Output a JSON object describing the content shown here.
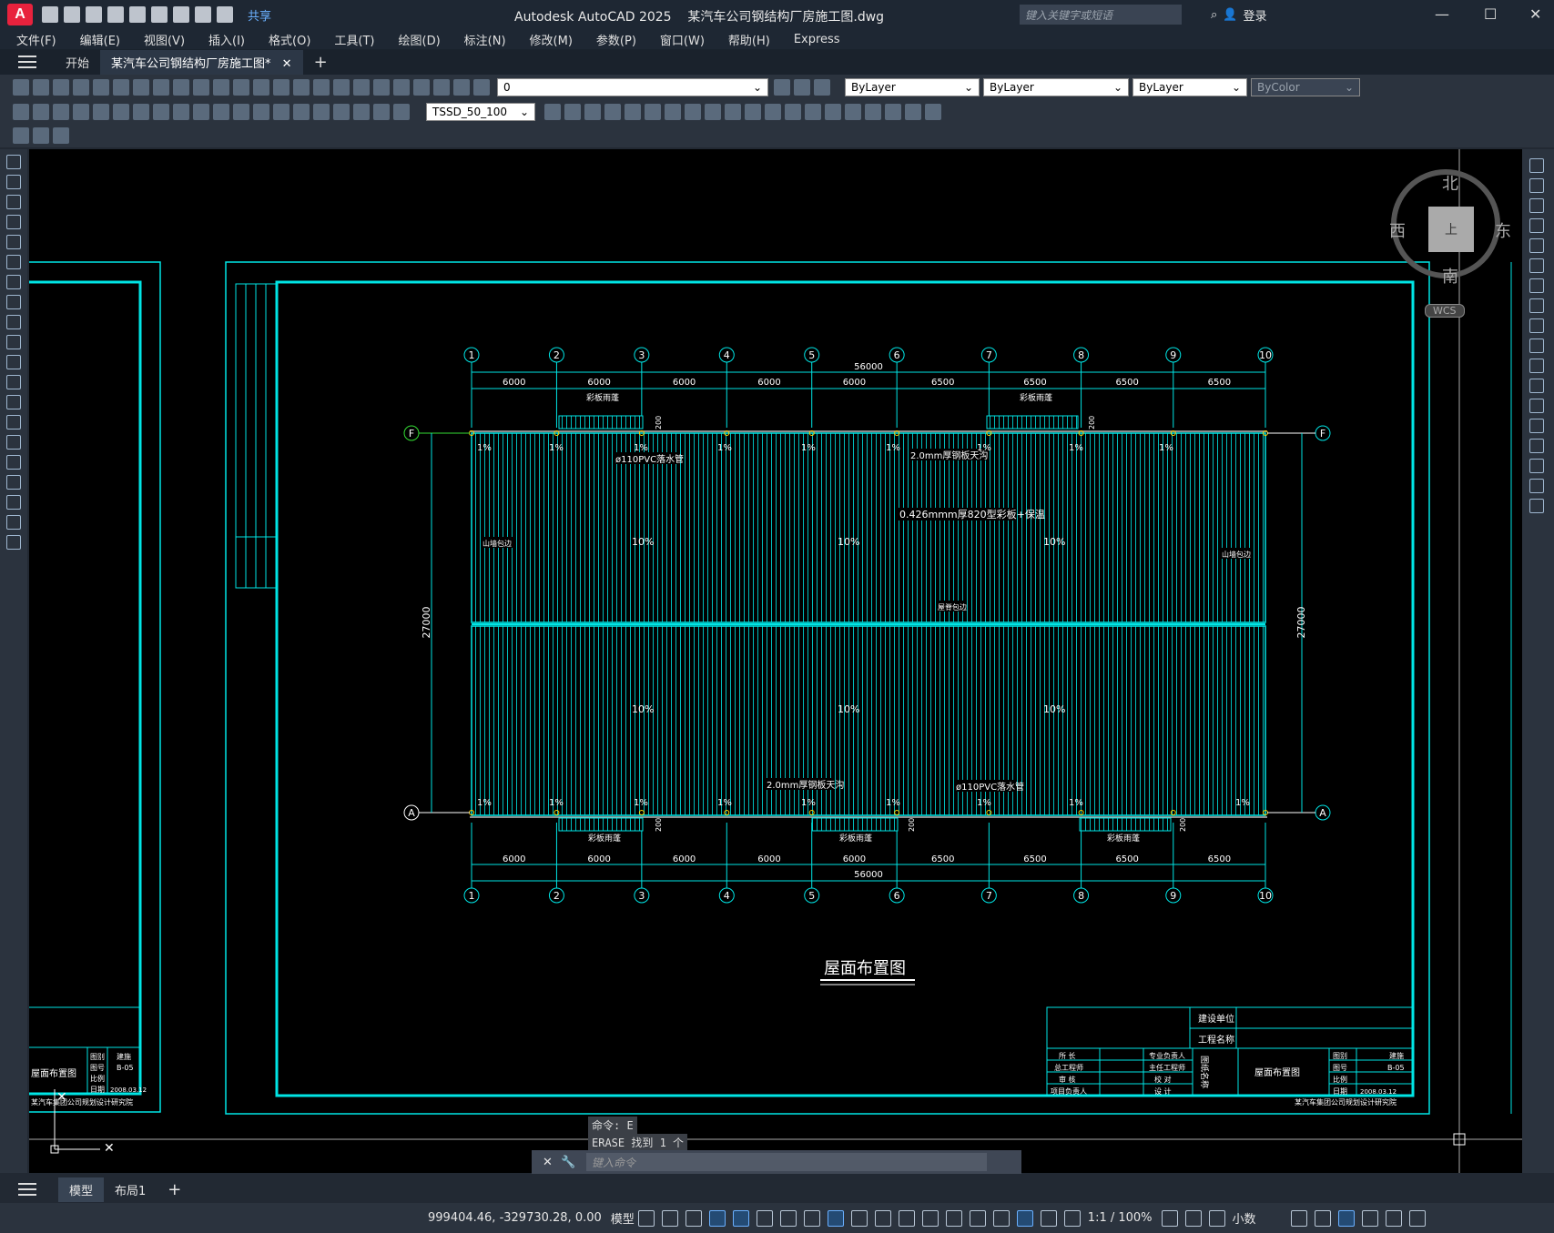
{
  "app": {
    "logo": "A",
    "title": "Autodesk AutoCAD 2025",
    "document": "某汽车公司钢结构厂房施工图.dwg",
    "share_label": "共享",
    "search_placeholder": "键入关键字或短语",
    "login_label": "登录"
  },
  "menu": [
    "文件(F)",
    "编辑(E)",
    "视图(V)",
    "插入(I)",
    "格式(O)",
    "工具(T)",
    "绘图(D)",
    "标注(N)",
    "修改(M)",
    "参数(P)",
    "窗口(W)",
    "帮助(H)",
    "Express"
  ],
  "doc_tabs": [
    {
      "label": "开始"
    },
    {
      "label": "某汽车公司钢结构厂房施工图*"
    }
  ],
  "toolbar": {
    "layer_value": "0",
    "color_value": "ByLayer",
    "linetype_value": "ByLayer",
    "lineweight_value": "ByLayer",
    "plotstyle_value": "ByColor",
    "dimstyle_value": "TSSD_50_100"
  },
  "viewcube": {
    "north": "北",
    "south": "南",
    "east": "东",
    "west": "西",
    "face": "上",
    "wcs": "WCS"
  },
  "drawing": {
    "axes_top": [
      "1",
      "2",
      "3",
      "4",
      "5",
      "6",
      "7",
      "8",
      "9",
      "10"
    ],
    "axes_side": [
      "F",
      "A"
    ],
    "spans": [
      "6000",
      "6000",
      "6000",
      "6000",
      "6000",
      "6500",
      "6500",
      "6500",
      "6500"
    ],
    "total_length": "56000",
    "total_width": "27000",
    "slope_small": "1%",
    "slope_large": "10%",
    "dim_200": "200",
    "labels": {
      "gutter_top": "彩板雨蓬",
      "downpipe": "ø110PVC落水管",
      "gutter_steel": "2.0mm厚钢板天沟",
      "roof_panel": "0.426mmm厚820型彩板+保温",
      "gable_flash": "山墙包边",
      "ridge": "屋脊包边"
    },
    "title": "屋面布置图",
    "title_block": {
      "build_unit": "建设单位",
      "project_name": "工程名称",
      "roles_left": [
        "所  长",
        "总工程师",
        "审  核",
        "项目负责人"
      ],
      "roles_right": [
        "专业负责人",
        "主任工程师",
        "校  对",
        "设  计"
      ],
      "drawing_type": "图纸名称",
      "drawing_name": "屋面布置图",
      "info_labels": [
        "图别",
        "图号",
        "比例",
        "日期"
      ],
      "info_values": [
        "建施",
        "B-05",
        "",
        "2008.03.12"
      ],
      "footer": "某汽车集团公司规划设计研究院"
    },
    "left_sheet": {
      "drawing_name": "屋面布置图",
      "info_labels": [
        "图别",
        "图号",
        "比例",
        "日期"
      ],
      "info_values": [
        "建施",
        "B-05",
        "",
        "2008.03.12"
      ],
      "footer": "某汽车集团公司规划设计研究院"
    }
  },
  "command": {
    "history1": "命令: E",
    "history2": "ERASE 找到 1 个",
    "placeholder": "键入命令"
  },
  "layout_tabs": [
    "模型",
    "布局1"
  ],
  "status": {
    "coords": "999404.46, -329730.28, 0.00",
    "model": "模型",
    "scale": "1:1 / 100%",
    "units": "小数"
  }
}
